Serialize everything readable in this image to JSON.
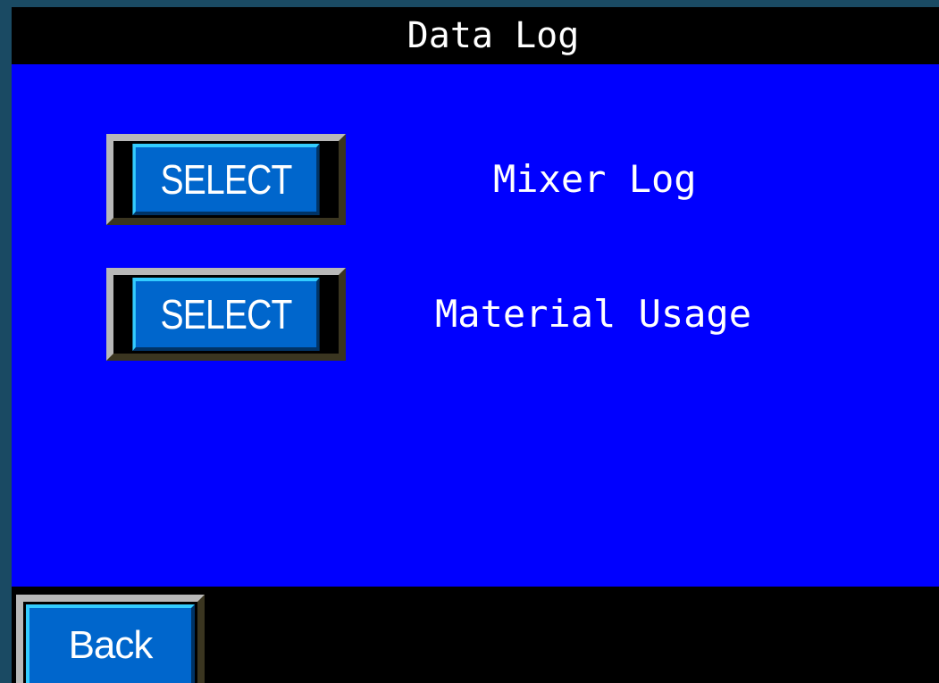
{
  "header": {
    "title": "Data Log"
  },
  "log_options": [
    {
      "button_label": "SELECT",
      "name": "Mixer Log"
    },
    {
      "button_label": "SELECT",
      "name": "Material Usage"
    }
  ],
  "footer": {
    "back_label": "Back"
  },
  "colors": {
    "panel": "#0000ff",
    "bars": "#000000",
    "button_face": "#0066cc",
    "button_highlight": "#33ccff",
    "frame": "#1a4a63"
  }
}
